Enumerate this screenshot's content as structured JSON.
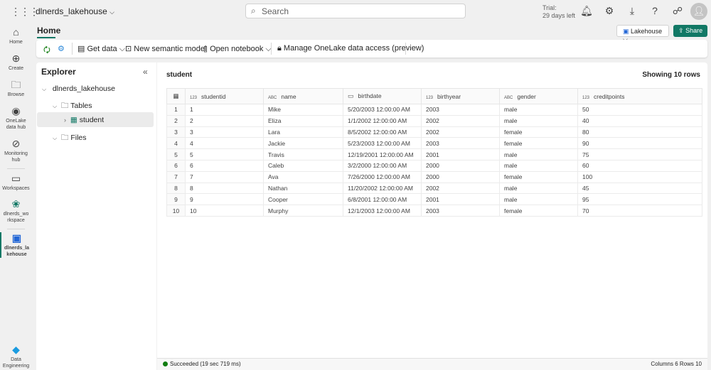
{
  "topbar": {
    "workspace_item": "dlnerds_lakehouse",
    "search_placeholder": "Search",
    "trial_line1": "Trial:",
    "trial_line2": "29 days left"
  },
  "rail": [
    {
      "label": "Home",
      "icon": "home-icon"
    },
    {
      "label": "Create",
      "icon": "plus-circle-icon"
    },
    {
      "label": "Browse",
      "icon": "folder-icon"
    },
    {
      "label": "OneLake data hub",
      "icon": "onelake-icon"
    },
    {
      "label": "Monitoring hub",
      "icon": "monitor-icon"
    },
    {
      "label": "Workspaces",
      "icon": "workspaces-icon"
    },
    {
      "label": "dlnerds_workspace",
      "icon": "workspace-group-icon"
    },
    {
      "label": "dlnerds_lakehouse",
      "icon": "lakehouse-icon"
    },
    {
      "label": "Data Engineering",
      "icon": "data-engineering-icon"
    }
  ],
  "tabs": {
    "home": "Home"
  },
  "header_buttons": {
    "lakehouse": "Lakehouse",
    "share": "Share"
  },
  "toolbar": {
    "get_data": "Get data",
    "new_semantic_model": "New semantic model",
    "open_notebook": "Open notebook",
    "manage_access": "Manage OneLake data access (preview)"
  },
  "explorer": {
    "title": "Explorer",
    "root": "dlnerds_lakehouse",
    "tables": "Tables",
    "student": "student",
    "files": "Files"
  },
  "main": {
    "table_name": "student",
    "showing": "Showing 10 rows"
  },
  "table": {
    "columns": [
      {
        "type": "123",
        "name": "studentid"
      },
      {
        "type": "ABC",
        "name": "name"
      },
      {
        "type": "date",
        "name": "birthdate"
      },
      {
        "type": "123",
        "name": "birthyear"
      },
      {
        "type": "ABC",
        "name": "gender"
      },
      {
        "type": "123",
        "name": "creditpoints"
      }
    ],
    "rows": [
      [
        "1",
        "1",
        "Mike",
        "5/20/2003 12:00:00 AM",
        "2003",
        "male",
        "50"
      ],
      [
        "2",
        "2",
        "Eliza",
        "1/1/2002 12:00:00 AM",
        "2002",
        "male",
        "40"
      ],
      [
        "3",
        "3",
        "Lara",
        "8/5/2002 12:00:00 AM",
        "2002",
        "female",
        "80"
      ],
      [
        "4",
        "4",
        "Jackie",
        "5/23/2003 12:00:00 AM",
        "2003",
        "female",
        "90"
      ],
      [
        "5",
        "5",
        "Travis",
        "12/19/2001 12:00:00 AM",
        "2001",
        "male",
        "75"
      ],
      [
        "6",
        "6",
        "Caleb",
        "3/2/2000 12:00:00 AM",
        "2000",
        "male",
        "60"
      ],
      [
        "7",
        "7",
        "Ava",
        "7/26/2000 12:00:00 AM",
        "2000",
        "female",
        "100"
      ],
      [
        "8",
        "8",
        "Nathan",
        "11/20/2002 12:00:00 AM",
        "2002",
        "male",
        "45"
      ],
      [
        "9",
        "9",
        "Cooper",
        "6/8/2001 12:00:00 AM",
        "2001",
        "male",
        "95"
      ],
      [
        "10",
        "10",
        "Murphy",
        "12/1/2003 12:00:00 AM",
        "2003",
        "female",
        "70"
      ]
    ]
  },
  "status": {
    "text": "Succeeded (19 sec 719 ms)",
    "summary": "Columns 6 Rows 10"
  },
  "colors": {
    "accent": "#117865",
    "success": "#107c10"
  }
}
